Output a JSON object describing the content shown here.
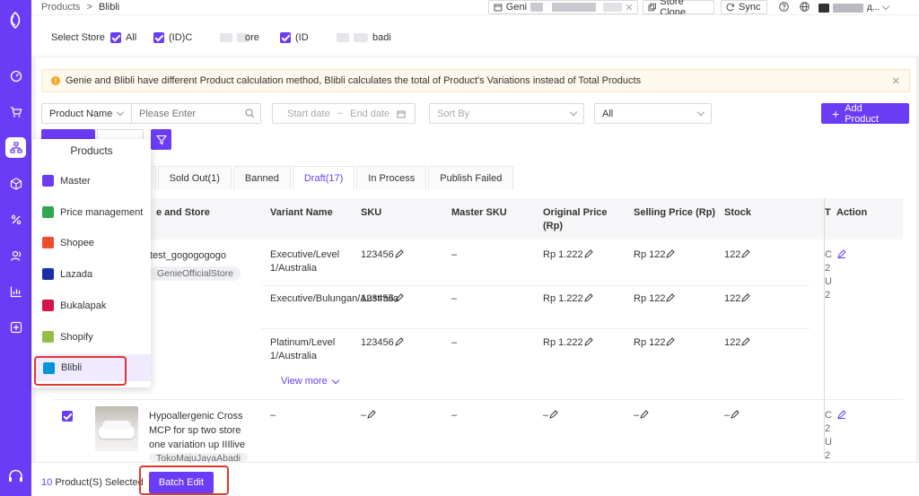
{
  "breadcrumb": {
    "parent": "Products",
    "sep": ">",
    "current": "Blibli"
  },
  "topbar": {
    "shop_label": "Geni",
    "store_clone": "Store Clone",
    "sync": "Sync",
    "user_suffix": "д..."
  },
  "store_select": {
    "label": "Select Store",
    "options": [
      {
        "label": "All",
        "checked": true
      },
      {
        "label": "(ID)C",
        "checked": true
      },
      {
        "label": "ore",
        "checked": false
      },
      {
        "label": "(ID",
        "checked": true
      },
      {
        "label": "badi",
        "checked": false
      }
    ]
  },
  "notice": {
    "text": "Genie and Blibli have different Product calculation method, Blibli calculates the total of Product's Variations instead of Total Products"
  },
  "filters": {
    "field": "Product Name",
    "search_placeholder": "Please Enter",
    "start_date": "Start date",
    "date_sep": "~",
    "end_date": "End date",
    "sort_by": "Sort By",
    "status": "All",
    "add_product": "Add Product"
  },
  "tabs": [
    {
      "label": ")"
    },
    {
      "label": "Sold Out(1)"
    },
    {
      "label": "Banned"
    },
    {
      "label": "Draft(17)",
      "active": true
    },
    {
      "label": "In Process"
    },
    {
      "label": "Publish Failed"
    }
  ],
  "table": {
    "headers": {
      "name": "e and Store",
      "variant": "Variant Name",
      "sku": "SKU",
      "master_sku": "Master SKU",
      "orig_price": "Original Price (Rp)",
      "sell_price": "Selling Price (Rp)",
      "stock": "Stock",
      "t": "T",
      "action": "Action"
    },
    "product1": {
      "name": "test_gogogogogo",
      "store": "GenieOfficialStore",
      "variants": [
        {
          "name": "Executive/Level 1/Australia",
          "sku": "123456",
          "master_sku": "–",
          "orig": "Rp 1.222",
          "sell": "Rp 122",
          "stock": "122"
        },
        {
          "name": "Executive/Bulungan/Australia",
          "sku": "123456",
          "master_sku": "–",
          "orig": "Rp 1.222",
          "sell": "Rp 122",
          "stock": "122"
        },
        {
          "name": "Platinum/Level 1/Australia",
          "sku": "123456",
          "master_sku": "–",
          "orig": "Rp 1.222",
          "sell": "Rp 122",
          "stock": "122"
        }
      ],
      "view_more": "View more"
    },
    "product2": {
      "name": "Hypoallergenic Cross MCP for sp two store one variation up IIIlive",
      "store": "TokoMajuJayaAbadi",
      "variant": "–",
      "sku": "–",
      "master_sku": "–",
      "orig": "–",
      "sell": "–",
      "stock": "–"
    }
  },
  "popup": {
    "title": "Products",
    "items": [
      {
        "label": "Master",
        "icon": "master-icon",
        "color": "#6b3cf5"
      },
      {
        "label": "Price management",
        "icon": "price-management-icon",
        "color": "#2fa84f"
      },
      {
        "label": "Shopee",
        "icon": "shopee-icon",
        "color": "#ee4d2d"
      },
      {
        "label": "Lazada",
        "icon": "lazada-icon",
        "color": "#1a2fa3"
      },
      {
        "label": "Bukalapak",
        "icon": "bukalapak-icon",
        "color": "#d71149"
      },
      {
        "label": "Shopify",
        "icon": "shopify-icon",
        "color": "#95bf47"
      },
      {
        "label": "Blibli",
        "icon": "blibli-icon",
        "color": "#0095da"
      }
    ]
  },
  "footer": {
    "count": "10",
    "selected_text": "Product(S) Selected",
    "batch_edit": "Batch Edit"
  },
  "colors": {
    "accent": "#6b3cf5",
    "highlight": "#e0382e"
  }
}
